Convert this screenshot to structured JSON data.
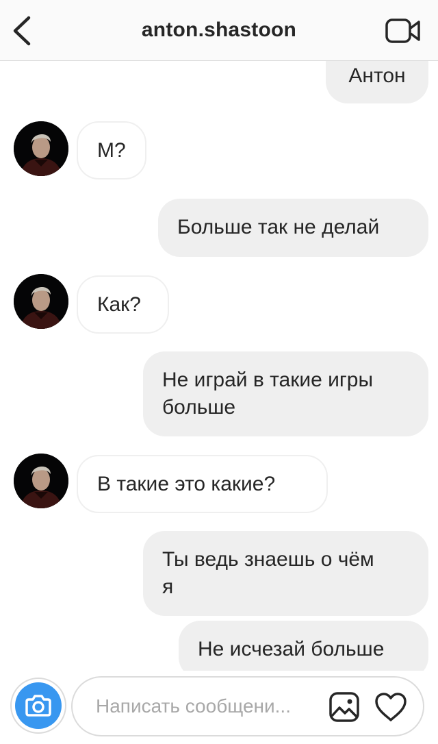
{
  "header": {
    "username": "anton.shastoon",
    "back_icon": "chevron-left-icon",
    "video_icon": "video-camera-icon"
  },
  "messages": [
    {
      "side": "outgoing",
      "text": "Антон"
    },
    {
      "side": "incoming",
      "text": "М?"
    },
    {
      "side": "outgoing",
      "text": "Больше так не делай"
    },
    {
      "side": "incoming",
      "text": "Как?"
    },
    {
      "side": "outgoing",
      "lines": [
        "Не играй в такие игры",
        "больше"
      ]
    },
    {
      "side": "incoming",
      "text": "В такие это какие?"
    },
    {
      "side": "outgoing",
      "lines": [
        "Ты ведь знаешь о чём",
        "я"
      ]
    },
    {
      "side": "outgoing",
      "text": "Не исчезай больше"
    }
  ],
  "composer": {
    "placeholder": "Написать сообщени...",
    "camera_icon": "camera-icon",
    "gallery_icon": "gallery-icon",
    "heart_icon": "heart-icon"
  },
  "colors": {
    "accent": "#3897f0",
    "outgoing_bubble": "#efefef",
    "border": "#dbdbdb"
  }
}
